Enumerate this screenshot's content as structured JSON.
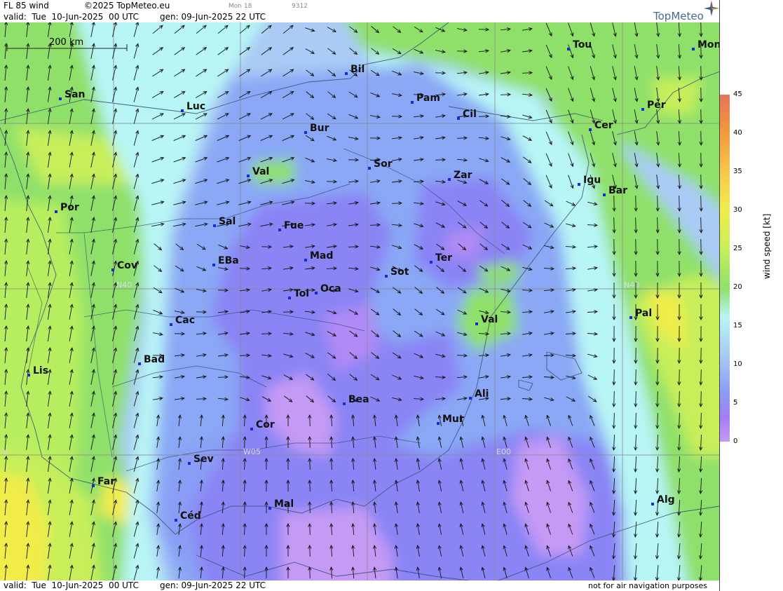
{
  "header": {
    "title": "FL 85 wind",
    "copyright": "©2025 TopMeteo.eu",
    "day_code": "Mon 18",
    "code": "9312",
    "valid": "valid:  Tue  10-Jun-2025  00 UTC",
    "gen": "gen: 09-Jun-2025 22 UTC"
  },
  "logo": {
    "text": "TopMeteo",
    "icon": "compass-star-icon"
  },
  "scale_bar": {
    "label": "200 km"
  },
  "footer": {
    "valid": "valid:  Tue  10-Jun-2025  00 UTC",
    "gen": "gen: 09-Jun-2025 22 UTC",
    "disclaimer": "not for air navigation purposes"
  },
  "colorbar": {
    "title": "wind speed [kt]",
    "ticks": [
      "45",
      "40",
      "35",
      "30",
      "25",
      "20",
      "15",
      "10",
      "5",
      "0"
    ],
    "colors": [
      "#e8735a",
      "#f29a3c",
      "#f7c64a",
      "#f2ec4a",
      "#c8ef5a",
      "#8fe06a",
      "#b8f5f5",
      "#a9cbf5",
      "#8a9cf5",
      "#a57cf5",
      "#c49af5"
    ]
  },
  "grid_labels": {
    "n40_left": "N40",
    "n40_right": "N40",
    "w05": "W05",
    "e00": "E00",
    "zero": "0"
  },
  "cities": [
    {
      "name": "Tou"
    },
    {
      "name": "Mon"
    },
    {
      "name": "Bil"
    },
    {
      "name": "San"
    },
    {
      "name": "Luc"
    },
    {
      "name": "Pam"
    },
    {
      "name": "Per"
    },
    {
      "name": "Cil"
    },
    {
      "name": "Bur"
    },
    {
      "name": "Cer"
    },
    {
      "name": "Sor"
    },
    {
      "name": "Val"
    },
    {
      "name": "Zar"
    },
    {
      "name": "Igu"
    },
    {
      "name": "Bar"
    },
    {
      "name": "Por"
    },
    {
      "name": "Sal"
    },
    {
      "name": "Fue"
    },
    {
      "name": "Mad"
    },
    {
      "name": "Cov"
    },
    {
      "name": "EBa"
    },
    {
      "name": "Ter"
    },
    {
      "name": "Sot"
    },
    {
      "name": "Tol"
    },
    {
      "name": "Oca"
    },
    {
      "name": "Cac"
    },
    {
      "name": "Pal"
    },
    {
      "name": "Val"
    },
    {
      "name": "Bad"
    },
    {
      "name": "Lis"
    },
    {
      "name": "Ali"
    },
    {
      "name": "Bea"
    },
    {
      "name": "Mur"
    },
    {
      "name": "Cor"
    },
    {
      "name": "Sev"
    },
    {
      "name": "Far"
    },
    {
      "name": "Mal"
    },
    {
      "name": "Alg"
    },
    {
      "name": "Céd"
    }
  ]
}
